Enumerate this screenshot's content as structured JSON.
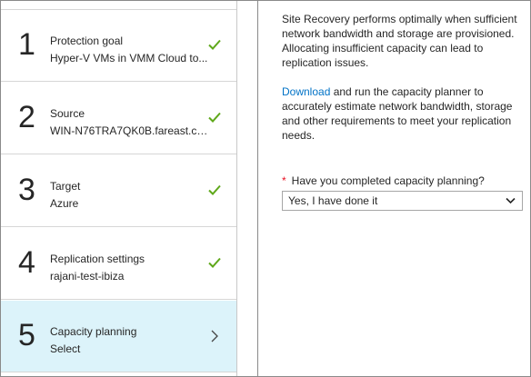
{
  "steps": [
    {
      "number": "1",
      "title": "Protection goal",
      "subtitle": "Hyper-V VMs in VMM Cloud to...",
      "status": "complete",
      "icon": "checkmark-icon"
    },
    {
      "number": "2",
      "title": "Source",
      "subtitle": "WIN-N76TRA7QK0B.fareast.cor...",
      "status": "complete",
      "icon": "checkmark-icon"
    },
    {
      "number": "3",
      "title": "Target",
      "subtitle": "Azure",
      "status": "complete",
      "icon": "checkmark-icon"
    },
    {
      "number": "4",
      "title": "Replication settings",
      "subtitle": "rajani-test-ibiza",
      "status": "complete",
      "icon": "checkmark-icon"
    },
    {
      "number": "5",
      "title": "Capacity planning",
      "subtitle": "Select",
      "status": "active",
      "icon": "chevron-right-icon"
    }
  ],
  "info": {
    "paragraph1": "Site Recovery performs optimally when sufficient network bandwidth and storage are provisioned. Allocating insufficient capacity can lead to replication issues.",
    "link_text": "Download",
    "paragraph2_rest": " and run the capacity planner to accurately estimate network bandwidth, storage and other requirements to meet your replication needs."
  },
  "form": {
    "required_marker": "*",
    "question": "Have you completed capacity planning?",
    "selected_value": "Yes, I have done it"
  },
  "colors": {
    "check_green": "#5fa81a",
    "active_bg": "#dcf3fa",
    "link_blue": "#0072c6",
    "required_red": "#e81123"
  }
}
